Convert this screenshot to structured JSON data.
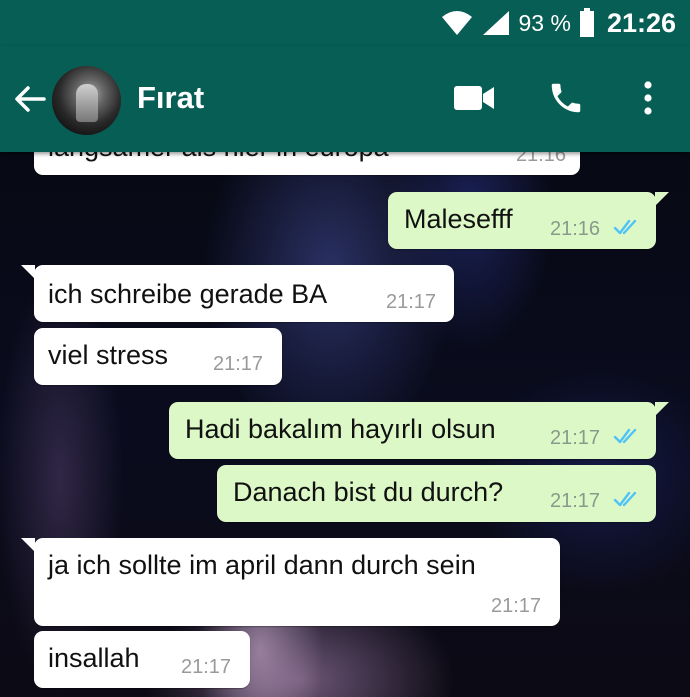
{
  "colors": {
    "header": "#075e54",
    "bubble_out": "#dcf8c6",
    "bubble_in": "#ffffff",
    "read_ticks": "#4fc3f7"
  },
  "status_bar": {
    "battery": "93 %",
    "time": "21:26",
    "icons": [
      "wifi-icon",
      "signal-icon",
      "battery-icon"
    ]
  },
  "header": {
    "contact_name": "Fırat",
    "icons": [
      "back-arrow-icon",
      "video-camera-icon",
      "phone-icon",
      "more-vert-icon"
    ]
  },
  "messages": [
    {
      "direction": "in",
      "text": "langsamer als hier in europa",
      "time": "21:16"
    },
    {
      "direction": "out",
      "text": "Malesefff",
      "time": "21:16",
      "status": "read"
    },
    {
      "direction": "in",
      "text": "ich schreibe gerade BA",
      "time": "21:17"
    },
    {
      "direction": "in",
      "text": "viel stress",
      "time": "21:17"
    },
    {
      "direction": "out",
      "text": "Hadi bakalım hayırlı olsun",
      "time": "21:17",
      "status": "read"
    },
    {
      "direction": "out",
      "text": "Danach bist du durch?",
      "time": "21:17",
      "status": "read"
    },
    {
      "direction": "in",
      "text": "ja ich sollte im  april dann durch sein",
      "time": "21:17"
    },
    {
      "direction": "in",
      "text": "insallah",
      "time": "21:17"
    }
  ]
}
